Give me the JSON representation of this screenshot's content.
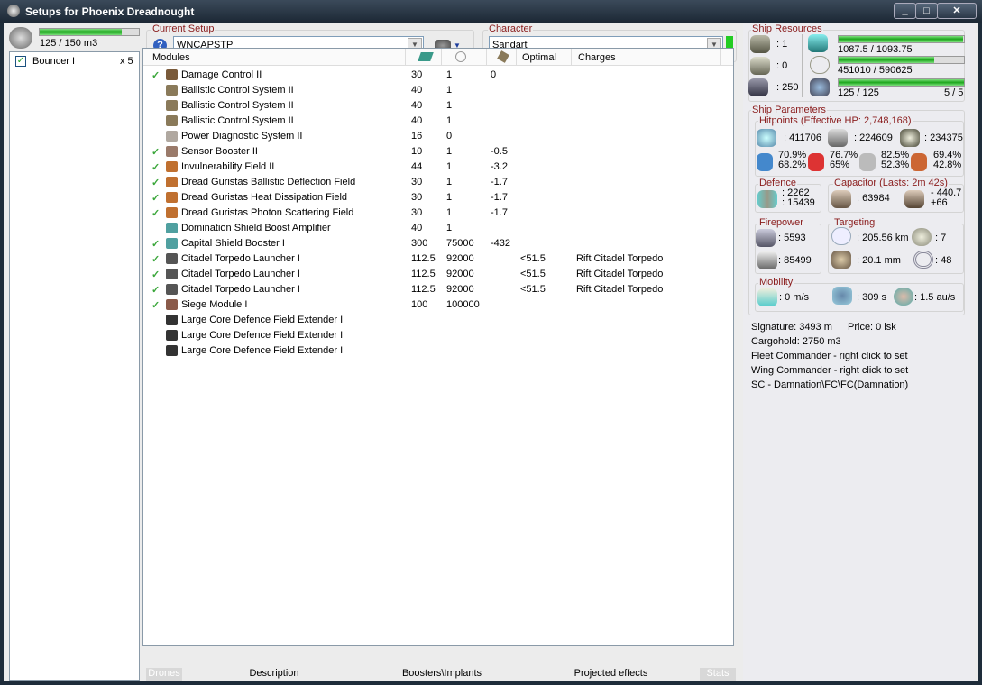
{
  "window": {
    "title": "Setups for Phoenix Dreadnought",
    "minimize": "_",
    "maximize": "□",
    "close": "✕"
  },
  "drones": {
    "bay": "125 / 150 m3",
    "bay_fill": 0.83,
    "items": [
      {
        "name": "Bouncer I",
        "count": "x 5",
        "checked": true
      }
    ]
  },
  "setup": {
    "label": "Current Setup",
    "value": "WNCAPSTP",
    "help": "?"
  },
  "character": {
    "label": "Character",
    "value": "Sandart"
  },
  "modules": {
    "headers": [
      "Modules",
      "",
      "",
      "",
      "Optimal",
      "Charges"
    ],
    "rows": [
      {
        "fit": true,
        "name": "Damage Control II",
        "cpu": "30",
        "pg": "1",
        "v": "0",
        "opt": "",
        "charge": "",
        "color": "#7a5a3a"
      },
      {
        "fit": false,
        "name": "Ballistic Control System II",
        "cpu": "40",
        "pg": "1",
        "v": "",
        "opt": "",
        "charge": "",
        "color": "#8a7a5a"
      },
      {
        "fit": false,
        "name": "Ballistic Control System II",
        "cpu": "40",
        "pg": "1",
        "v": "",
        "opt": "",
        "charge": "",
        "color": "#8a7a5a"
      },
      {
        "fit": false,
        "name": "Ballistic Control System II",
        "cpu": "40",
        "pg": "1",
        "v": "",
        "opt": "",
        "charge": "",
        "color": "#8a7a5a"
      },
      {
        "fit": false,
        "name": "Power Diagnostic System II",
        "cpu": "16",
        "pg": "0",
        "v": "",
        "opt": "",
        "charge": "",
        "color": "#b0a8a0"
      },
      {
        "fit": true,
        "name": "Sensor Booster II",
        "cpu": "10",
        "pg": "1",
        "v": "-0.5",
        "opt": "",
        "charge": "",
        "color": "#9a7a6a"
      },
      {
        "fit": true,
        "name": "Invulnerability Field II",
        "cpu": "44",
        "pg": "1",
        "v": "-3.2",
        "opt": "",
        "charge": "",
        "color": "#c07030"
      },
      {
        "fit": true,
        "name": "Dread Guristas Ballistic Deflection Field",
        "cpu": "30",
        "pg": "1",
        "v": "-1.7",
        "opt": "",
        "charge": "",
        "color": "#c07030"
      },
      {
        "fit": true,
        "name": "Dread Guristas Heat Dissipation Field",
        "cpu": "30",
        "pg": "1",
        "v": "-1.7",
        "opt": "",
        "charge": "",
        "color": "#c07030"
      },
      {
        "fit": true,
        "name": "Dread Guristas Photon Scattering Field",
        "cpu": "30",
        "pg": "1",
        "v": "-1.7",
        "opt": "",
        "charge": "",
        "color": "#c07030"
      },
      {
        "fit": false,
        "name": "Domination Shield Boost Amplifier",
        "cpu": "40",
        "pg": "1",
        "v": "",
        "opt": "",
        "charge": "",
        "color": "#50a0a0"
      },
      {
        "fit": true,
        "name": "Capital Shield Booster I",
        "cpu": "300",
        "pg": "75000",
        "v": "-432",
        "opt": "",
        "charge": "",
        "color": "#50a0a0"
      },
      {
        "fit": true,
        "name": "Citadel Torpedo Launcher I",
        "cpu": "112.5",
        "pg": "92000",
        "v": "",
        "opt": "<51.5",
        "charge": "Rift Citadel Torpedo",
        "color": "#555"
      },
      {
        "fit": true,
        "name": "Citadel Torpedo Launcher I",
        "cpu": "112.5",
        "pg": "92000",
        "v": "",
        "opt": "<51.5",
        "charge": "Rift Citadel Torpedo",
        "color": "#555"
      },
      {
        "fit": true,
        "name": "Citadel Torpedo Launcher I",
        "cpu": "112.5",
        "pg": "92000",
        "v": "",
        "opt": "<51.5",
        "charge": "Rift Citadel Torpedo",
        "color": "#555"
      },
      {
        "fit": true,
        "name": "Siege Module I",
        "cpu": "100",
        "pg": "100000",
        "v": "",
        "opt": "",
        "charge": "",
        "color": "#8a5a4a"
      },
      {
        "fit": false,
        "name": "Large Core Defence Field Extender I",
        "cpu": "",
        "pg": "",
        "v": "",
        "opt": "",
        "charge": "",
        "color": "#333"
      },
      {
        "fit": false,
        "name": "Large Core Defence Field Extender I",
        "cpu": "",
        "pg": "",
        "v": "",
        "opt": "",
        "charge": "",
        "color": "#333"
      },
      {
        "fit": false,
        "name": "Large Core Defence Field Extender I",
        "cpu": "",
        "pg": "",
        "v": "",
        "opt": "",
        "charge": "",
        "color": "#333"
      }
    ]
  },
  "tabs": [
    "Drones",
    "Description",
    "Boosters\\Implants",
    "Projected effects",
    "Stats"
  ],
  "resources": {
    "label": "Ship Resources",
    "turrets": ": 1",
    "launchers": ": 0",
    "drone_bw": ": 250",
    "cpu": "1087.5 / 1093.75",
    "cpu_fill": 0.994,
    "pg": "451010 / 590625",
    "pg_fill": 0.764,
    "calib": "125 / 125",
    "calib_fill": 1.0,
    "rigs": "5 / 5"
  },
  "params": {
    "label": "Ship Parameters",
    "hp_label": "Hitpoints (Effective HP: 2,748,168)",
    "shield": ": 411706",
    "armor": ": 224609",
    "structure": ": 234375",
    "resists": [
      [
        "70.9%",
        "68.2%"
      ],
      [
        "76.7%",
        "65%"
      ],
      [
        "82.5%",
        "52.3%"
      ],
      [
        "69.4%",
        "42.8%"
      ]
    ],
    "def_label": "Defence",
    "def1": ": 2262",
    "def2": ": 15439",
    "cap_label": "Capacitor (Lasts: 2m 42s)",
    "cap": ": 63984",
    "cap_use": "- 440.7",
    "cap_regen": "+66",
    "fp_label": "Firepower",
    "dps": ": 5593",
    "volley": ": 85499",
    "tgt_label": "Targeting",
    "range": ": 205.56 km",
    "targets": ": 7",
    "sig": ": 20.1 mm",
    "scan": ": 48",
    "mob_label": "Mobility",
    "speed": ": 0 m/s",
    "align": ": 309 s",
    "warp": ": 1.5 au/s"
  },
  "info": {
    "signature": "Signature: 3493 m",
    "price": "Price: 0 isk",
    "cargo": "Cargohold: 2750 m3",
    "fleet": "Fleet Commander - right click to set",
    "wing": "Wing Commander - right click to set",
    "squad": "SC - Damnation\\FC\\FC(Damnation)"
  }
}
